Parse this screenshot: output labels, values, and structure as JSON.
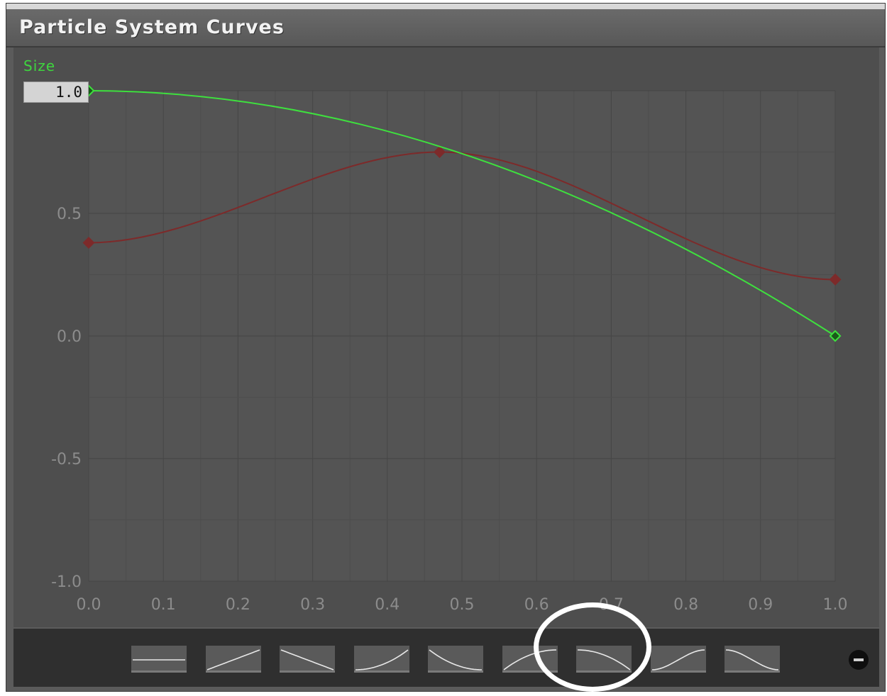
{
  "window": {
    "title": "Particle System Curves"
  },
  "curve_editor": {
    "curve_label": "Size",
    "value_field": "1.0",
    "y_tick_labels": [
      "1.0",
      "0.5",
      "0.0",
      "-0.5",
      "-1.0"
    ],
    "x_tick_labels": [
      "0.0",
      "0.1",
      "0.2",
      "0.3",
      "0.4",
      "0.5",
      "0.6",
      "0.7",
      "0.8",
      "0.9",
      "1.0"
    ],
    "colors": {
      "size_curve": "#3ee03e",
      "secondary_curve": "#7d2a2a",
      "label": "#3ed53e"
    }
  },
  "chart_data": {
    "type": "line",
    "xlabel": "",
    "ylabel": "",
    "xlim": [
      0,
      1
    ],
    "ylim": [
      -1,
      1
    ],
    "grid": true,
    "series": [
      {
        "name": "Size",
        "color": "#3ee03e",
        "x": [
          0.0,
          1.0
        ],
        "y": [
          1.0,
          0.0
        ],
        "keys": [
          [
            0.0,
            1.0,
            0.0
          ],
          [
            1.0,
            0.0,
            -1.95
          ]
        ]
      },
      {
        "color": "#7d2a2a",
        "x": [
          0.0,
          0.47,
          1.0
        ],
        "y": [
          0.38,
          0.75,
          0.23
        ],
        "keys": [
          [
            0.0,
            0.38,
            0.0
          ],
          [
            0.47,
            0.75,
            0.0
          ],
          [
            1.0,
            0.23,
            0.0
          ]
        ]
      }
    ]
  },
  "presets": {
    "items": [
      {
        "icon": "flat-line-preset-icon"
      },
      {
        "icon": "linear-up-preset-icon"
      },
      {
        "icon": "linear-down-preset-icon"
      },
      {
        "icon": "ease-in-up-preset-icon"
      },
      {
        "icon": "ease-out-down-preset-icon"
      },
      {
        "icon": "ease-out-up-preset-icon"
      },
      {
        "icon": "ease-in-down-preset-icon"
      },
      {
        "icon": "ease-in-out-up-preset-icon"
      },
      {
        "icon": "ease-in-out-down-preset-icon"
      }
    ],
    "remove_icon": "minus-circle-icon"
  }
}
